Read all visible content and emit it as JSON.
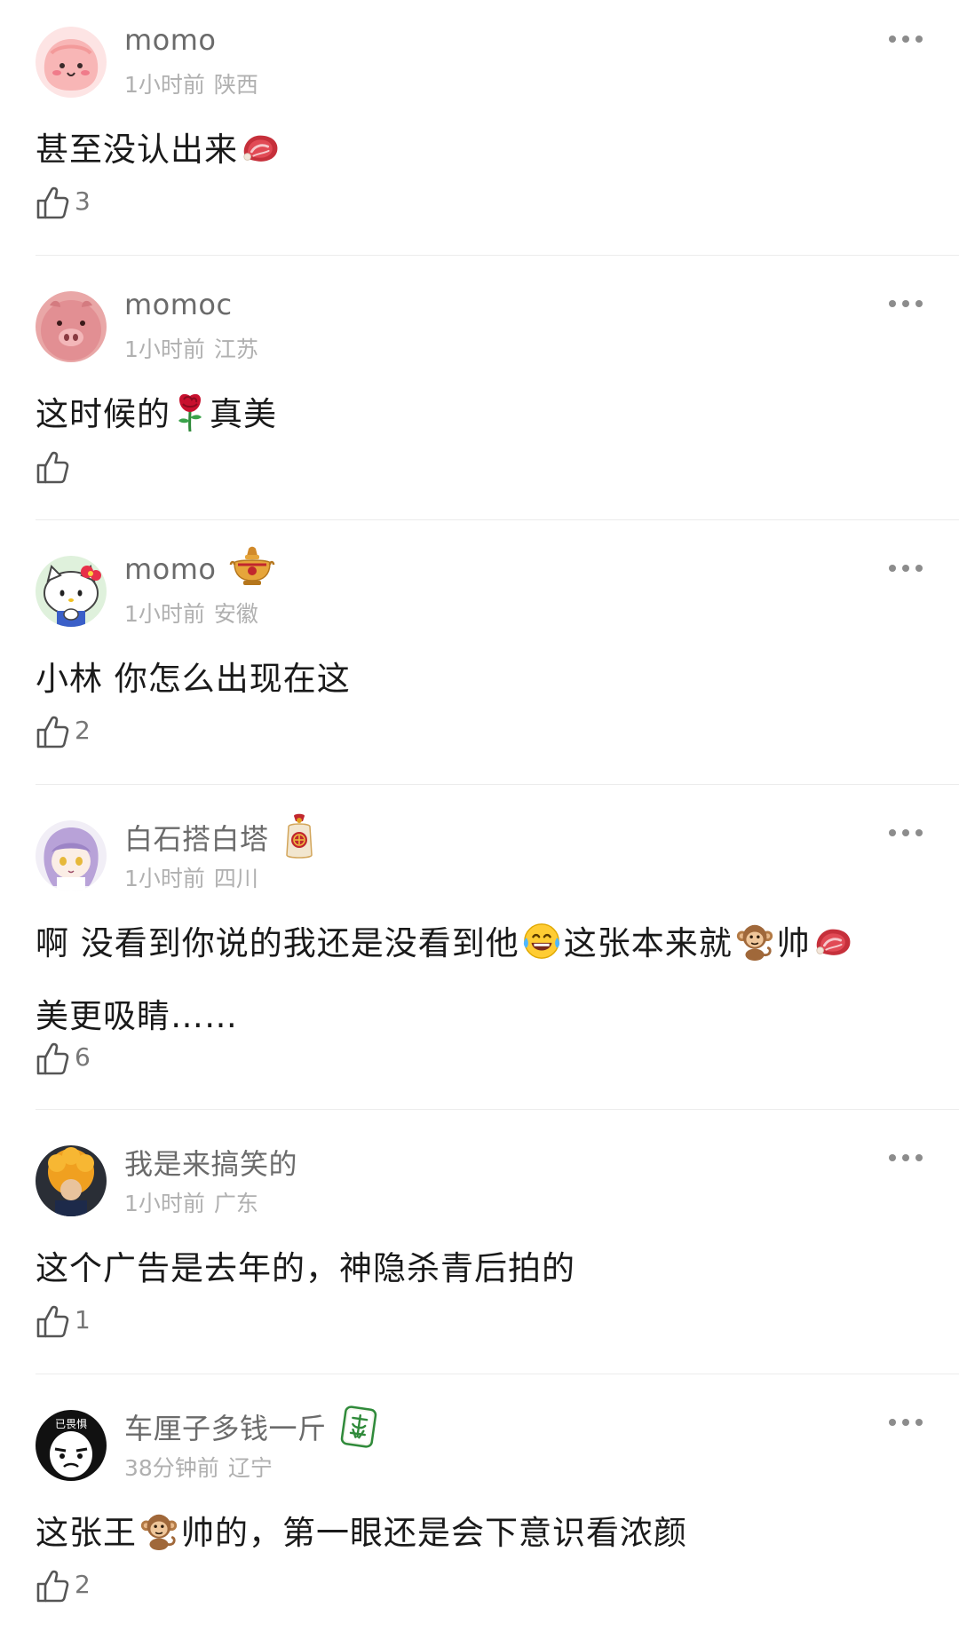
{
  "comments": [
    {
      "username": "momo",
      "time": "1小时前",
      "location": "陕西",
      "text_parts": [
        "甚至没认出来"
      ],
      "emojis": [
        "steak-emoji"
      ],
      "likes": "3",
      "avatar": "pink-blob-avatar"
    },
    {
      "username": "momoc",
      "time": "1小时前",
      "location": "江苏",
      "text_parts": [
        "这时候的",
        "真美"
      ],
      "emojis": [
        "rose-emoji"
      ],
      "likes": "",
      "avatar": "pink-pig-avatar"
    },
    {
      "username": "momo",
      "time": "1小时前",
      "location": "安徽",
      "text_parts": [
        "小林 你怎么出现在这"
      ],
      "badge": "hotpot-badge",
      "likes": "2",
      "avatar": "hello-kitty-avatar"
    },
    {
      "username": "白石搭白塔",
      "time": "1小时前",
      "location": "四川",
      "text_parts": [
        "啊 没看到你说的我还是没看到他",
        "这张本来就",
        "帅",
        "美更吸睛……"
      ],
      "emojis": [
        "laugh-cry-emoji",
        "monkey-emoji",
        "steak-emoji"
      ],
      "badge": "lucky-bag-badge",
      "likes": "6",
      "avatar": "anime-girl-avatar"
    },
    {
      "username": "我是来搞笑的",
      "time": "1小时前",
      "location": "广东",
      "text_parts": [
        "这个广告是去年的，神隐杀青后拍的"
      ],
      "likes": "1",
      "avatar": "orange-hair-avatar"
    },
    {
      "username": "车厘子多钱一斤",
      "time": "38分钟前",
      "location": "辽宁",
      "text_parts": [
        "这张王",
        "帅的，第一眼还是会下意识看浓颜"
      ],
      "emojis": [
        "monkey-emoji"
      ],
      "badge": "mahjong-fa-badge",
      "avatar_text": "已畏惧",
      "likes": "2",
      "avatar": "meme-face-avatar"
    }
  ],
  "icons": {
    "like": "thumbs-up-icon",
    "more": "more-dots-icon"
  },
  "colors": {
    "username": "#6b6b6b",
    "meta": "#b0b0b0",
    "text": "#1a1a1a",
    "divider": "#ececec"
  }
}
